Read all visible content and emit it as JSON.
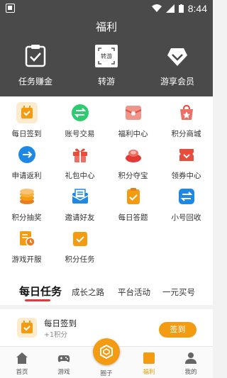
{
  "statusbar": {
    "time": "8:44"
  },
  "header": {
    "title": "福利"
  },
  "top_actions": [
    {
      "label": "任务赚金",
      "icon": "task-clipboard-icon"
    },
    {
      "label": "转游",
      "icon": "transfer-game-icon",
      "badge": "转游"
    },
    {
      "label": "游享会员",
      "icon": "vip-diamond-icon"
    }
  ],
  "grid": [
    {
      "label": "每日签到",
      "icon": "daily-checkin-icon",
      "color": "#f39c12"
    },
    {
      "label": "账号交易",
      "icon": "account-trade-icon",
      "color": "#2ecc71"
    },
    {
      "label": "福利中心",
      "icon": "welfare-envelope-icon",
      "color": "#e74c3c"
    },
    {
      "label": "积分商城",
      "icon": "points-mall-icon",
      "color": "#e74c3c"
    },
    {
      "label": "申请返利",
      "icon": "rebate-icon",
      "color": "#1e88e5"
    },
    {
      "label": "礼包中心",
      "icon": "gift-icon",
      "color": "#e74c3c"
    },
    {
      "label": "积分夺宝",
      "icon": "treasure-icon",
      "color": "#e53935"
    },
    {
      "label": "领券中心",
      "icon": "coupon-icon",
      "color": "#e74c3c"
    },
    {
      "label": "积分抽奖",
      "icon": "lottery-coins-icon",
      "color": "#f39c12"
    },
    {
      "label": "邀请好友",
      "icon": "invite-mail-icon",
      "color": "#1e88e5"
    },
    {
      "label": "每日答题",
      "icon": "daily-quiz-icon",
      "color": "#f39c12"
    },
    {
      "label": "小号回收",
      "icon": "recycle-icon",
      "color": "#1e88e5"
    },
    {
      "label": "游戏开服",
      "icon": "server-open-icon",
      "color": "#f39c12"
    },
    {
      "label": "积分任务",
      "icon": "points-task-icon",
      "color": "#f39c12"
    }
  ],
  "tabs": [
    {
      "label": "每日任务",
      "active": true
    },
    {
      "label": "成长之路",
      "active": false
    },
    {
      "label": "平台活动",
      "active": false
    },
    {
      "label": "一元买号",
      "active": false
    }
  ],
  "task": {
    "title": "每日签到",
    "subtitle": "+1积分",
    "button": "签到"
  },
  "nav": [
    {
      "label": "首页",
      "icon": "home-icon"
    },
    {
      "label": "游戏",
      "icon": "gamepad-icon"
    },
    {
      "label": "圈子",
      "icon": "circle-hex-icon"
    },
    {
      "label": "福利",
      "icon": "welfare-box-icon",
      "active": true
    },
    {
      "label": "我的",
      "icon": "profile-icon"
    }
  ],
  "colors": {
    "header_bg": "#4a4a4a",
    "accent": "#f39c12",
    "tab_underline": "#e53935"
  }
}
